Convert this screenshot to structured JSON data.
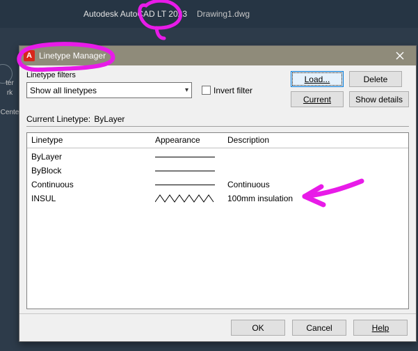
{
  "app": {
    "title": "Autodesk AutoCAD LT 2023",
    "file": "Drawing1.dwg"
  },
  "left_palette": {
    "item1": "ter",
    "item2": "rk",
    "item3": "Cente"
  },
  "dialog": {
    "logo_letter": "A",
    "title": "Linetype Manager",
    "filters_label": "Linetype filters",
    "combo_value": "Show all linetypes",
    "invert_label": "Invert filter",
    "buttons": {
      "load": "Load...",
      "delete": "Delete",
      "current": "Current",
      "show_details": "Show details"
    },
    "current_label": "Current Linetype:",
    "current_value": "ByLayer",
    "columns": {
      "linetype": "Linetype",
      "appearance": "Appearance",
      "description": "Description"
    },
    "rows": [
      {
        "name": "ByLayer",
        "desc": ""
      },
      {
        "name": "ByBlock",
        "desc": ""
      },
      {
        "name": "Continuous",
        "desc": "Continuous"
      },
      {
        "name": "INSUL",
        "desc": "100mm insulation"
      }
    ],
    "footer": {
      "ok": "OK",
      "cancel": "Cancel",
      "help": "Help"
    }
  },
  "annotations": {
    "note": "magenta freehand markup on screenshot"
  }
}
